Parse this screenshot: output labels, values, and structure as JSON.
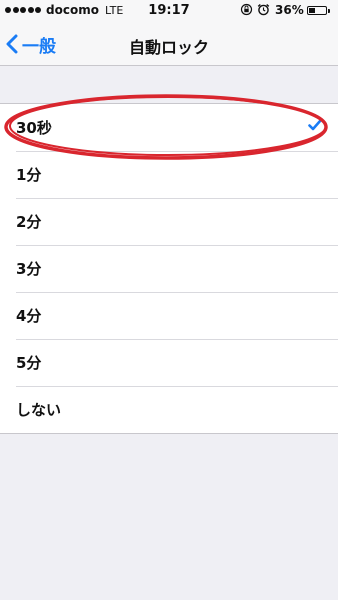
{
  "status_bar": {
    "carrier": "docomo",
    "network": "LTE",
    "time": "19:17",
    "battery_percent": "36%",
    "battery_level": 0.36,
    "signal_bars_filled": 5,
    "signal_bars_total": 5,
    "icons": [
      "rotation-lock-icon",
      "alarm-icon"
    ]
  },
  "nav": {
    "back_label": "一般",
    "title": "自動ロック"
  },
  "options": [
    {
      "label": "30秒",
      "selected": true
    },
    {
      "label": "1分",
      "selected": false
    },
    {
      "label": "2分",
      "selected": false
    },
    {
      "label": "3分",
      "selected": false
    },
    {
      "label": "4分",
      "selected": false
    },
    {
      "label": "5分",
      "selected": false
    },
    {
      "label": "しない",
      "selected": false
    }
  ],
  "colors": {
    "accent": "#1a7cf5",
    "annotation": "#d9262e",
    "background": "#efeff4"
  }
}
